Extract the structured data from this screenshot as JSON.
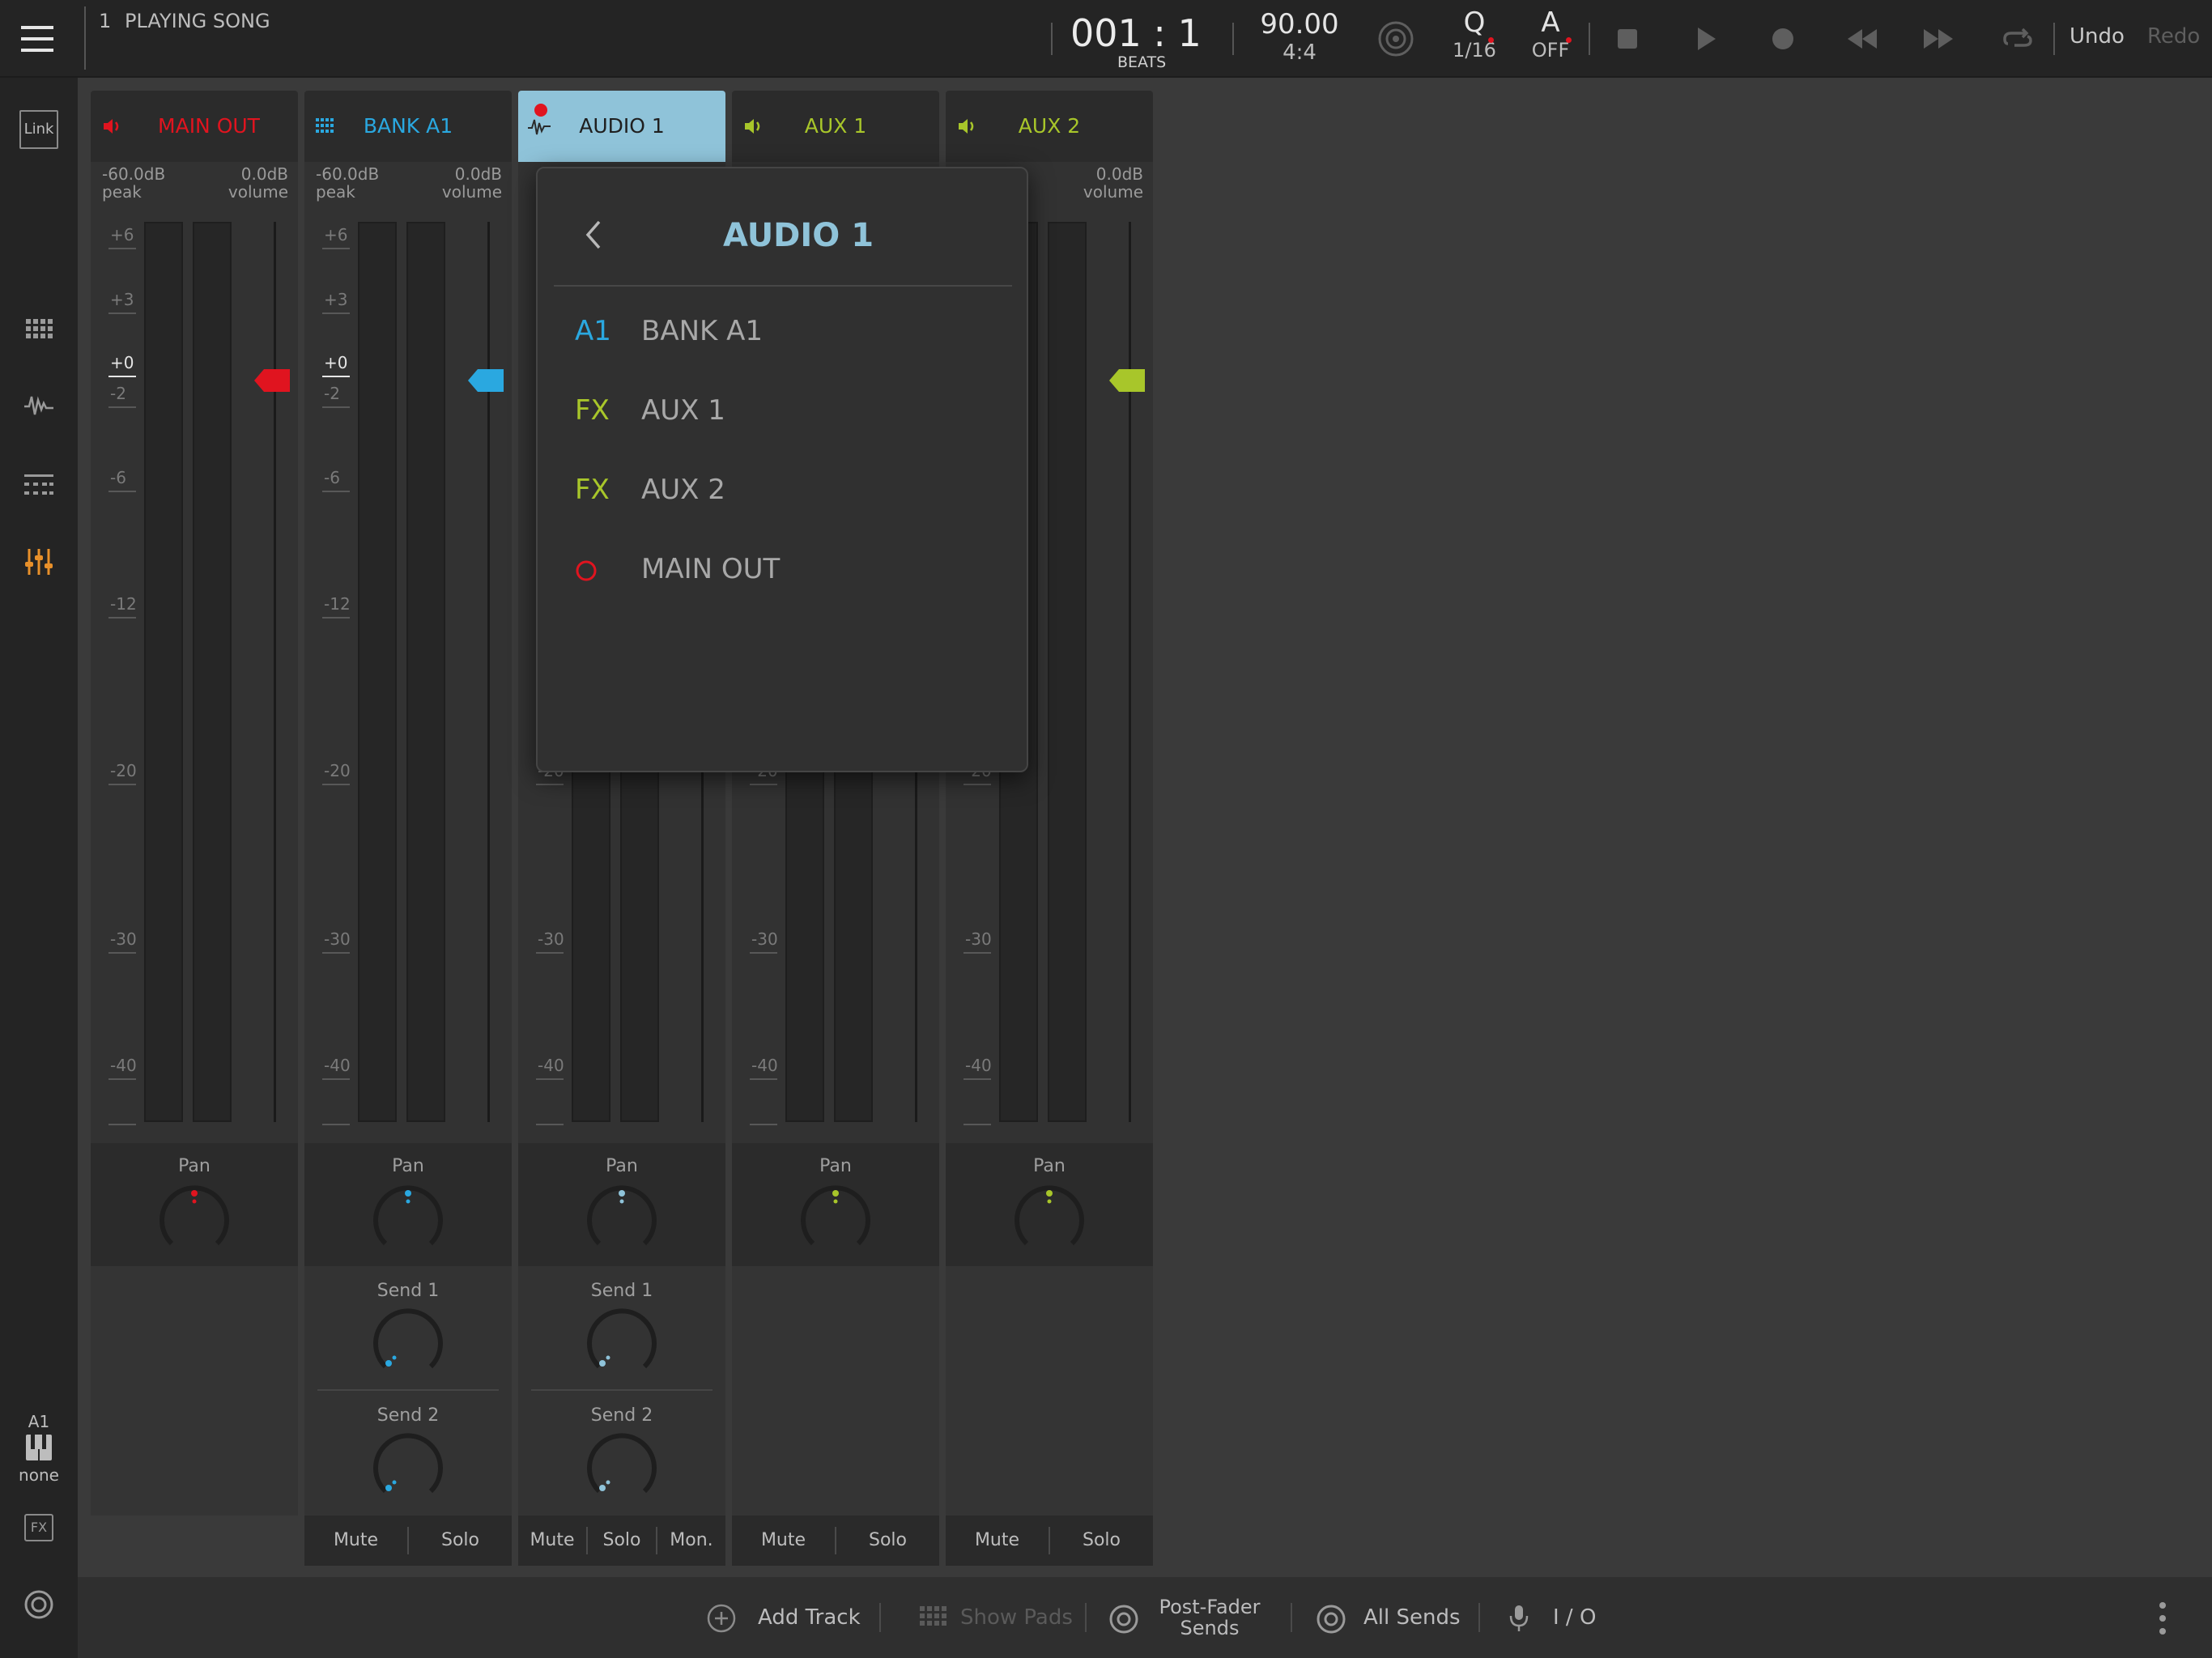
{
  "topbar": {
    "song_number": "1",
    "song_name": "PLAYING SONG",
    "position": "001 : 1",
    "position_unit": "BEATS",
    "tempo": "90.00",
    "time_signature": "4:4",
    "quantize_label": "Q",
    "quantize_value": "1/16",
    "automation_label": "A",
    "automation_value": "OFF",
    "undo_label": "Undo",
    "redo_label": "Redo"
  },
  "sidebar": {
    "link_label": "Link",
    "bank_label": "A1",
    "instrument_label": "none",
    "fx_label": "FX"
  },
  "channels": [
    {
      "name": "MAIN OUT",
      "color": "#e0141f",
      "peak_value": "-60.0dB",
      "peak_label": "peak",
      "volume_value": "0.0dB",
      "volume_label": "volume",
      "pan_label": "Pan"
    },
    {
      "name": "BANK A1",
      "color": "#2aa8e0",
      "peak_value": "-60.0dB",
      "peak_label": "peak",
      "volume_value": "0.0dB",
      "volume_label": "volume",
      "pan_label": "Pan",
      "send1_label": "Send 1",
      "send2_label": "Send 2",
      "mute_label": "Mute",
      "solo_label": "Solo"
    },
    {
      "name": "AUDIO 1",
      "color": "#8fc3d9",
      "pan_label": "Pan",
      "send1_label": "Send 1",
      "send2_label": "Send 2",
      "mute_label": "Mute",
      "solo_label": "Solo",
      "monitor_label": "Mon."
    },
    {
      "name": "AUX 1",
      "color": "#a8c62a",
      "pan_label": "Pan",
      "mute_label": "Mute",
      "solo_label": "Solo"
    },
    {
      "name": "AUX 2",
      "color": "#a8c62a",
      "volume_value": "0.0dB",
      "volume_label": "volume",
      "pan_label": "Pan",
      "mute_label": "Mute",
      "solo_label": "Solo"
    }
  ],
  "scale_labels": [
    "+6",
    "+3",
    "+0",
    "-2",
    "-6",
    "-12",
    "-20",
    "-30",
    "-40"
  ],
  "popup": {
    "title": "AUDIO 1",
    "items": [
      {
        "prefix": "A1",
        "name": "BANK A1",
        "color": "#2aa8e0"
      },
      {
        "prefix": "FX",
        "name": "AUX 1",
        "color": "#a8c62a"
      },
      {
        "prefix": "FX",
        "name": "AUX 2",
        "color": "#a8c62a"
      },
      {
        "prefix": "O",
        "name": "MAIN OUT",
        "color": "#e0141f"
      }
    ]
  },
  "bottombar": {
    "add_track_label": "Add Track",
    "show_pads_label": "Show Pads",
    "post_fader_label_1": "Post-Fader",
    "post_fader_label_2": "Sends",
    "all_sends_label": "All Sends",
    "io_label": "I / O"
  },
  "colors": {
    "accent_orange": "#e8902a",
    "record_red": "#e0141f"
  }
}
